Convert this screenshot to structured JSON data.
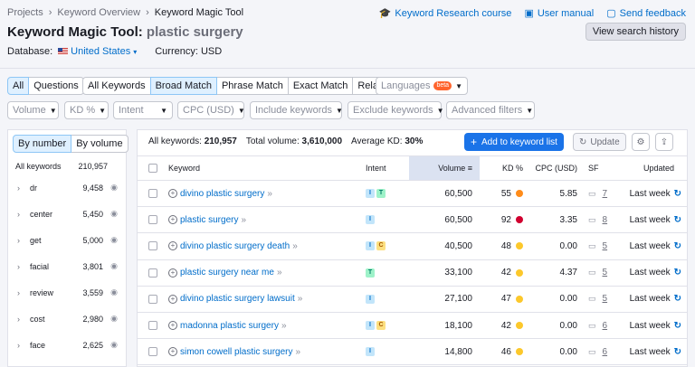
{
  "breadcrumb": [
    "Projects",
    "Keyword Overview",
    "Keyword Magic Tool"
  ],
  "top_links": [
    {
      "label": "Keyword Research course",
      "icon": "graduation-cap-icon"
    },
    {
      "label": "User manual",
      "icon": "book-icon"
    },
    {
      "label": "Send feedback",
      "icon": "chat-icon"
    }
  ],
  "title": {
    "tool": "Keyword Magic Tool:",
    "keyword": "plastic surgery"
  },
  "history_button": "View search history",
  "database": {
    "label": "Database:",
    "value": "United States",
    "currency_label": "Currency: USD"
  },
  "match_tabs": {
    "all": "All",
    "questions": "Questions",
    "modes": [
      "All Keywords",
      "Broad Match",
      "Phrase Match",
      "Exact Match",
      "Related"
    ],
    "selected": "Broad Match"
  },
  "languages": {
    "label": "Languages",
    "badge": "beta"
  },
  "filters": [
    "Volume",
    "KD %",
    "Intent",
    "CPC (USD)",
    "Include keywords",
    "Exclude keywords",
    "Advanced filters"
  ],
  "sidebar": {
    "toggle": [
      "By number",
      "By volume"
    ],
    "header": {
      "label": "All keywords",
      "count": "210,957"
    },
    "groups": [
      {
        "word": "dr",
        "count": "9,458"
      },
      {
        "word": "center",
        "count": "5,450"
      },
      {
        "word": "get",
        "count": "5,000"
      },
      {
        "word": "facial",
        "count": "3,801"
      },
      {
        "word": "review",
        "count": "3,559"
      },
      {
        "word": "cost",
        "count": "2,980"
      },
      {
        "word": "face",
        "count": "2,625"
      }
    ]
  },
  "summary": {
    "all_keywords_label": "All keywords:",
    "all_keywords": "210,957",
    "total_volume_label": "Total volume:",
    "total_volume": "3,610,000",
    "avg_kd_label": "Average KD:",
    "avg_kd": "30%"
  },
  "actions": {
    "add": "Add to keyword list",
    "update": "Update"
  },
  "columns": [
    "Keyword",
    "Intent",
    "Volume",
    "KD %",
    "CPC (USD)",
    "SF",
    "Updated"
  ],
  "rows": [
    {
      "keyword": "divino plastic surgery",
      "intent": [
        "I",
        "T"
      ],
      "volume": "60,500",
      "kd": "55",
      "kd_color": "#ff8c1a",
      "cpc": "5.85",
      "sf": "7",
      "updated": "Last week"
    },
    {
      "keyword": "plastic surgery",
      "intent": [
        "I"
      ],
      "volume": "60,500",
      "kd": "92",
      "kd_color": "#d1002f",
      "cpc": "3.35",
      "sf": "8",
      "updated": "Last week"
    },
    {
      "keyword": "divino plastic surgery death",
      "intent": [
        "I",
        "C"
      ],
      "volume": "40,500",
      "kd": "48",
      "kd_color": "#fcc82b",
      "cpc": "0.00",
      "sf": "5",
      "updated": "Last week"
    },
    {
      "keyword": "plastic surgery near me",
      "intent": [
        "T"
      ],
      "volume": "33,100",
      "kd": "42",
      "kd_color": "#fcc82b",
      "cpc": "4.37",
      "sf": "5",
      "updated": "Last week"
    },
    {
      "keyword": "divino plastic surgery lawsuit",
      "intent": [
        "I"
      ],
      "volume": "27,100",
      "kd": "47",
      "kd_color": "#fcc82b",
      "cpc": "0.00",
      "sf": "5",
      "updated": "Last week"
    },
    {
      "keyword": "madonna plastic surgery",
      "intent": [
        "I",
        "C"
      ],
      "volume": "18,100",
      "kd": "42",
      "kd_color": "#fcc82b",
      "cpc": "0.00",
      "sf": "6",
      "updated": "Last week"
    },
    {
      "keyword": "simon cowell plastic surgery",
      "intent": [
        "I"
      ],
      "volume": "14,800",
      "kd": "46",
      "kd_color": "#fcc82b",
      "cpc": "0.00",
      "sf": "6",
      "updated": "Last week"
    }
  ]
}
